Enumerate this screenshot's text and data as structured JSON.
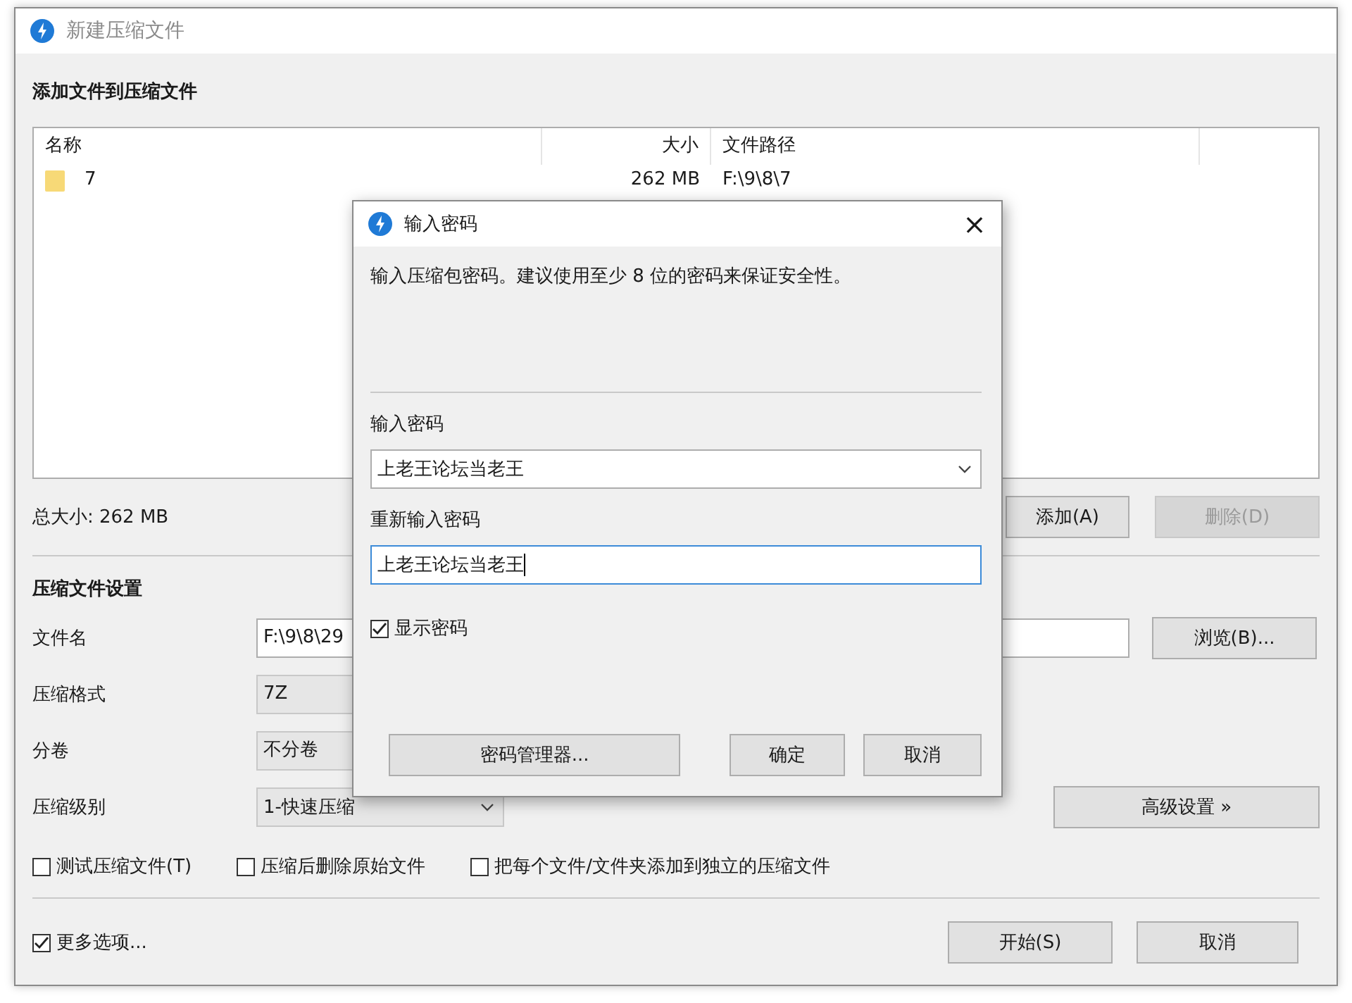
{
  "window": {
    "title": "新建压缩文件"
  },
  "files_section": {
    "heading": "添加文件到压缩文件",
    "columns": [
      "名称",
      "大小",
      "文件路径"
    ],
    "rows": [
      {
        "name": "7",
        "size": "262 MB",
        "path": "F:\\9\\8\\7"
      }
    ],
    "total": "总大小: 262 MB",
    "buttons": [
      {
        "label": "添加(A)",
        "disabled": false
      },
      {
        "label": "删除(D)",
        "disabled": true
      }
    ]
  },
  "settings": {
    "heading": "压缩文件设置",
    "fields": [
      {
        "kind": "text",
        "label": "文件名",
        "value": "F:\\9\\8\\29",
        "button": "浏览(B)..."
      },
      {
        "kind": "partial",
        "label": "压缩格式",
        "value": "7Z"
      },
      {
        "kind": "partial",
        "label": "分卷",
        "value": "不分卷"
      },
      {
        "kind": "select",
        "label": "压缩级别",
        "value": "1-快速压缩",
        "button": "高级设置 »"
      }
    ],
    "options": [
      {
        "label": "测试压缩文件(T)",
        "checked": false
      },
      {
        "label": "压缩后删除原始文件",
        "checked": false
      },
      {
        "label": "把每个文件/文件夹添加到独立的压缩文件",
        "checked": false
      }
    ]
  },
  "footer": {
    "more_options": {
      "label": "更多选项...",
      "checked": true
    },
    "buttons": [
      "开始(S)",
      "取消"
    ]
  },
  "password_dialog": {
    "title": "输入密码",
    "close": "×",
    "description": "输入压缩包密码。建议使用至少 8 位的密码来保证安全性。",
    "password_label": "输入密码",
    "password": "上老王论坛当老王",
    "repeat_label": "重新输入密码",
    "repeat_password": "上老王论坛当老王",
    "show_password": {
      "label": "显示密码",
      "checked": true
    },
    "buttons": [
      "密码管理器...",
      "确定",
      "取消"
    ]
  }
}
